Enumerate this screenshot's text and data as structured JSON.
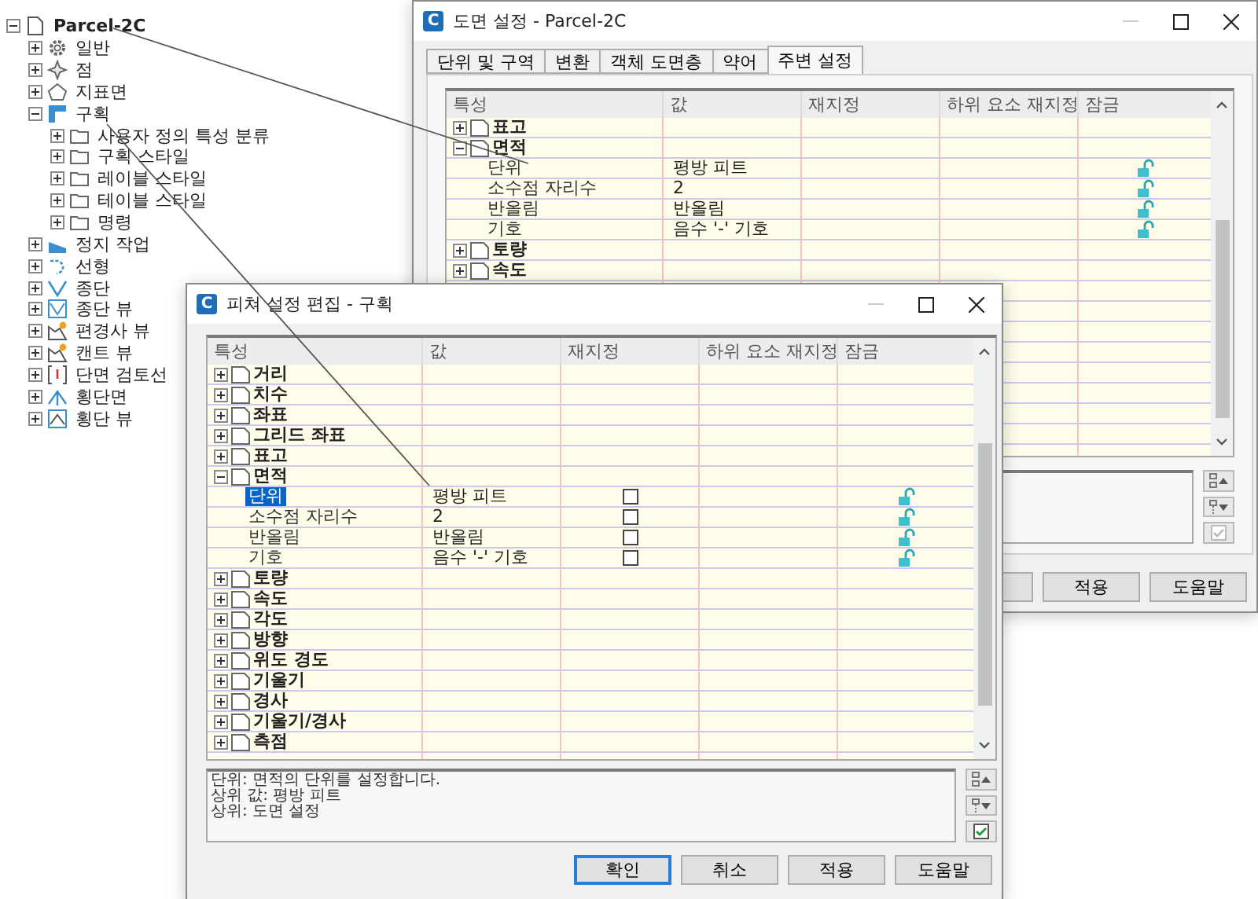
{
  "tree": {
    "label": "Parcel-2C",
    "kind": "document",
    "expanded": true,
    "children": [
      {
        "label": "일반",
        "kind": "gear",
        "expanded": false
      },
      {
        "label": "점",
        "kind": "point",
        "expanded": false
      },
      {
        "label": "지표면",
        "kind": "surface",
        "expanded": false
      },
      {
        "label": "구획",
        "kind": "parcel",
        "expanded": true,
        "children": [
          {
            "label": "사용자 정의 특성 분류",
            "kind": "folder",
            "expanded": false
          },
          {
            "label": "구획 스타일",
            "kind": "folder",
            "expanded": false
          },
          {
            "label": "레이블 스타일",
            "kind": "folder",
            "expanded": false
          },
          {
            "label": "테이블 스타일",
            "kind": "folder",
            "expanded": false
          },
          {
            "label": "명령",
            "kind": "folder",
            "expanded": false
          }
        ]
      },
      {
        "label": "정지 작업",
        "kind": "grading",
        "expanded": false
      },
      {
        "label": "선형",
        "kind": "alignment",
        "expanded": false
      },
      {
        "label": "종단",
        "kind": "profile",
        "expanded": false
      },
      {
        "label": "종단 뷰",
        "kind": "profile_view",
        "expanded": false
      },
      {
        "label": "편경사 뷰",
        "kind": "chart_view",
        "expanded": false
      },
      {
        "label": "캔트 뷰",
        "kind": "chart_view",
        "expanded": false
      },
      {
        "label": "단면 검토선",
        "kind": "sample_line",
        "expanded": false
      },
      {
        "label": "횡단면",
        "kind": "section",
        "expanded": false
      },
      {
        "label": "횡단 뷰",
        "kind": "section_view",
        "expanded": false
      }
    ]
  },
  "drawing_settings": {
    "logo": "C",
    "title": "도면 설정 - Parcel-2C",
    "tabs": [
      {
        "label": "단위 및 구역",
        "selected": false
      },
      {
        "label": "변환",
        "selected": false
      },
      {
        "label": "객체 도면층",
        "selected": false
      },
      {
        "label": "약어",
        "selected": false
      },
      {
        "label": "주변 설정",
        "selected": true
      }
    ],
    "grid": {
      "columns": [
        "특성",
        "값",
        "재지정",
        "하위 요소 재지정",
        "잠금"
      ],
      "rows": [
        {
          "label": "표고",
          "expanded": false
        },
        {
          "label": "면적",
          "expanded": true,
          "children": [
            {
              "name": "단위",
              "value": "평방 피트",
              "locked": false
            },
            {
              "name": "소수점 자리수",
              "value": "2",
              "locked": false
            },
            {
              "name": "반올림",
              "value": "반올림",
              "locked": false
            },
            {
              "name": "기호",
              "value": "음수 '-' 기호",
              "locked": false
            }
          ]
        },
        {
          "label": "토량",
          "expanded": false
        },
        {
          "label": "속도",
          "expanded": false
        }
      ]
    },
    "description_toggle": {
      "enabled": false
    },
    "buttons": [
      {
        "label": "적용",
        "default": false
      },
      {
        "label": "도움말",
        "default": false
      }
    ]
  },
  "feature_settings": {
    "logo": "C",
    "title": "피쳐 설정 편집 - 구획",
    "grid": {
      "columns": [
        "특성",
        "값",
        "재지정",
        "하위 요소 재지정",
        "잠금"
      ],
      "rows": [
        {
          "label": "거리",
          "expanded": false
        },
        {
          "label": "치수",
          "expanded": false
        },
        {
          "label": "좌표",
          "expanded": false
        },
        {
          "label": "그리드 좌표",
          "expanded": false
        },
        {
          "label": "표고",
          "expanded": false
        },
        {
          "label": "면적",
          "expanded": true,
          "children": [
            {
              "name": "단위",
              "value": "평방 피트",
              "override": false,
              "locked": false,
              "selected": true
            },
            {
              "name": "소수점 자리수",
              "value": "2",
              "override": false,
              "locked": false,
              "selected": false
            },
            {
              "name": "반올림",
              "value": "반올림",
              "override": false,
              "locked": false,
              "selected": false
            },
            {
              "name": "기호",
              "value": "음수 '-' 기호",
              "override": false,
              "locked": false,
              "selected": false
            }
          ]
        },
        {
          "label": "토량",
          "expanded": false
        },
        {
          "label": "속도",
          "expanded": false
        },
        {
          "label": "각도",
          "expanded": false
        },
        {
          "label": "방향",
          "expanded": false
        },
        {
          "label": "위도 경도",
          "expanded": false
        },
        {
          "label": "기울기",
          "expanded": false
        },
        {
          "label": "경사",
          "expanded": false
        },
        {
          "label": "기울기/경사",
          "expanded": false
        },
        {
          "label": "측점",
          "expanded": false
        }
      ]
    },
    "description": [
      "단위: 면적의 단위를 설정합니다.",
      "상위 값: 평방 피트",
      "상위: 도면 설정"
    ],
    "description_toggle": {
      "enabled": true
    },
    "buttons": [
      {
        "label": "확인",
        "default": true
      },
      {
        "label": "취소",
        "default": false
      },
      {
        "label": "적용",
        "default": false
      },
      {
        "label": "도움말",
        "default": false
      }
    ]
  }
}
